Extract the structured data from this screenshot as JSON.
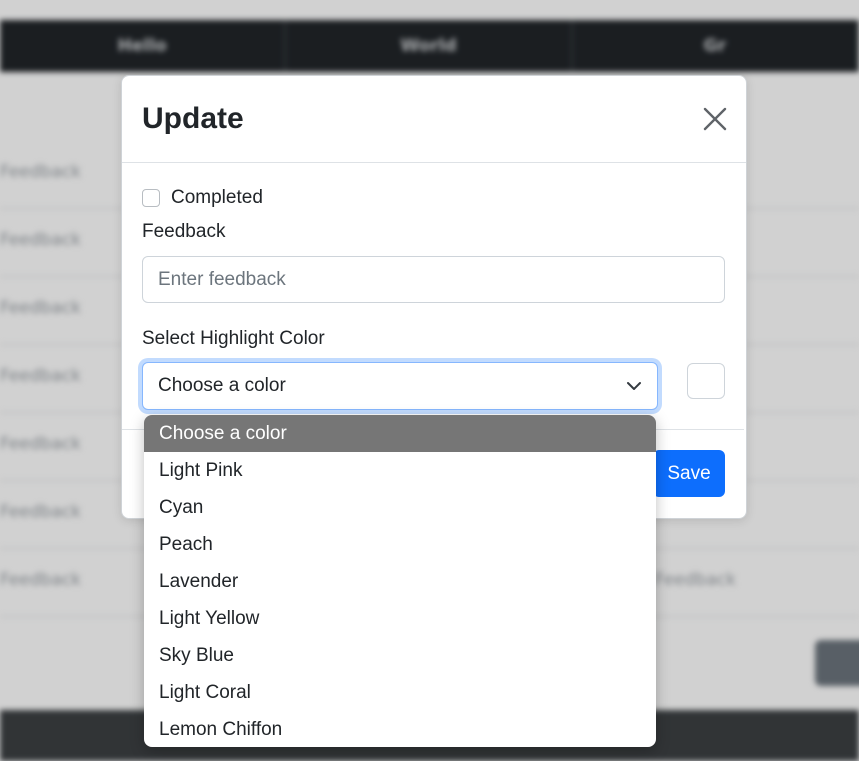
{
  "background": {
    "header_columns": [
      "Hello",
      "World",
      "Gr"
    ],
    "row_cells": [
      "Feedback",
      "Feedback",
      "Feedback",
      "Feedback",
      "Feedback",
      "Feedback",
      "Feedback"
    ],
    "row_right_cell": "Feedback"
  },
  "modal": {
    "title": "Update",
    "completed_label": "Completed",
    "completed_checked": false,
    "feedback_label": "Feedback",
    "feedback_placeholder": "Enter feedback",
    "feedback_value": "",
    "color_label": "Select Highlight Color",
    "color_selected": "Choose a color",
    "swatch_color": "#ffffff",
    "save_label": "Save"
  },
  "dropdown": {
    "options": [
      "Choose a color",
      "Light Pink",
      "Cyan",
      "Peach",
      "Lavender",
      "Light Yellow",
      "Sky Blue",
      "Light Coral",
      "Lemon Chiffon"
    ],
    "highlighted": "Choose a color"
  },
  "colors": {
    "primary": "#0d6efd",
    "dark_bar": "#212529",
    "highlight_option": "#767676"
  },
  "icons": {
    "close": "close-icon",
    "chevron": "chevron-down-icon"
  }
}
